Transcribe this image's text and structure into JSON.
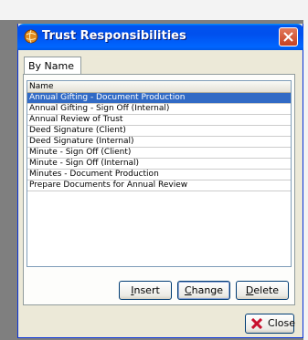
{
  "window": {
    "title": "Trust Responsibilities"
  },
  "tabs": [
    {
      "label": "By Name"
    }
  ],
  "list": {
    "column_header": "Name",
    "items": [
      "Annual Gifting - Document Production",
      "Annual Gifting - Sign Off (Internal)",
      "Annual Review of Trust",
      "Deed Signature (Client)",
      "Deed Signature (Internal)",
      "Minute - Sign Off (Client)",
      "Minute - Sign Off (Internal)",
      "Minutes - Document Production",
      "Prepare Documents for Annual Review"
    ],
    "selected_index": 0
  },
  "buttons": {
    "insert": {
      "label_mnemonic": "I",
      "label_rest": "nsert"
    },
    "change": {
      "label_mnemonic": "C",
      "label_rest": "hange"
    },
    "delete": {
      "label_mnemonic": "D",
      "label_rest": "elete"
    },
    "close": "Close"
  },
  "icons": {
    "app": "app-globe-icon",
    "window_close": "close-icon",
    "close_button": "red-x-icon"
  },
  "colors": {
    "titlebar": "#0053ee",
    "selection": "#316ac5",
    "close_red": "#c64121"
  }
}
